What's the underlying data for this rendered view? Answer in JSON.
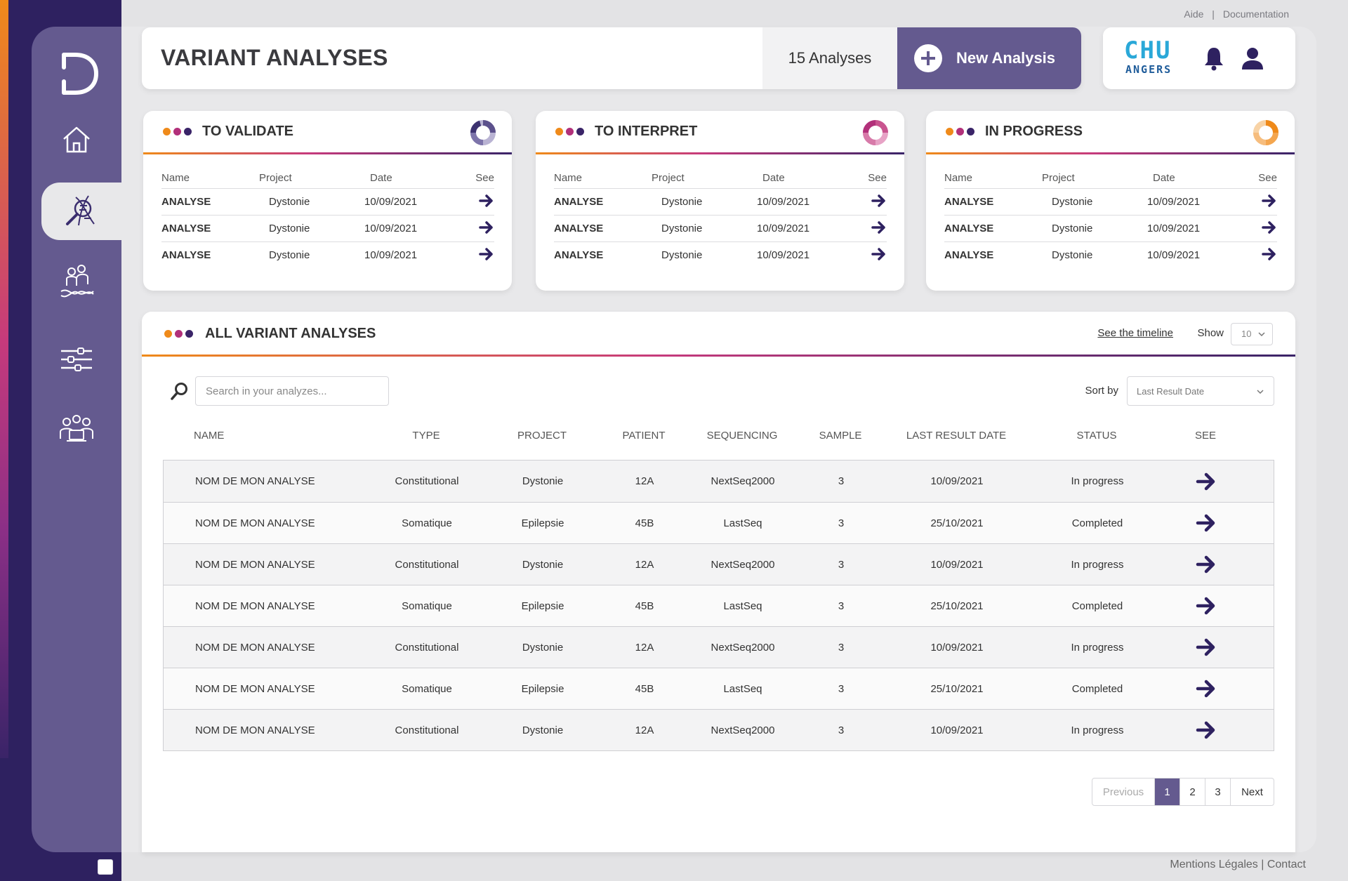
{
  "top_links": {
    "help": "Aide",
    "separator": "|",
    "docs": "Documentation"
  },
  "header": {
    "title": "VARIANT ANALYSES",
    "count": "15 Analyses",
    "new_button": "New Analysis"
  },
  "org": {
    "logo_line1": "CHU",
    "logo_line2": "ANGERS"
  },
  "colors": {
    "primary": "#645a8f",
    "dark": "#2e2160",
    "orange": "#ef8a1a",
    "magenta": "#b2307a"
  },
  "cards": [
    {
      "title": "TO VALIDATE",
      "headers": {
        "name": "Name",
        "project": "Project",
        "date": "Date",
        "see": "See"
      },
      "rows": [
        {
          "name": "ANALYSE",
          "project": "Dystonie",
          "date": "10/09/2021"
        },
        {
          "name": "ANALYSE",
          "project": "Dystonie",
          "date": "10/09/2021"
        },
        {
          "name": "ANALYSE",
          "project": "Dystonie",
          "date": "10/09/2021"
        }
      ]
    },
    {
      "title": "TO INTERPRET",
      "headers": {
        "name": "Name",
        "project": "Project",
        "date": "Date",
        "see": "See"
      },
      "rows": [
        {
          "name": "ANALYSE",
          "project": "Dystonie",
          "date": "10/09/2021"
        },
        {
          "name": "ANALYSE",
          "project": "Dystonie",
          "date": "10/09/2021"
        },
        {
          "name": "ANALYSE",
          "project": "Dystonie",
          "date": "10/09/2021"
        }
      ]
    },
    {
      "title": "IN PROGRESS",
      "headers": {
        "name": "Name",
        "project": "Project",
        "date": "Date",
        "see": "See"
      },
      "rows": [
        {
          "name": "ANALYSE",
          "project": "Dystonie",
          "date": "10/09/2021"
        },
        {
          "name": "ANALYSE",
          "project": "Dystonie",
          "date": "10/09/2021"
        },
        {
          "name": "ANALYSE",
          "project": "Dystonie",
          "date": "10/09/2021"
        }
      ]
    }
  ],
  "all": {
    "title": "ALL VARIANT ANALYSES",
    "timeline_link": "See the timeline",
    "show_label": "Show",
    "show_value": "10",
    "search_placeholder": "Search in your analyzes...",
    "sort_label": "Sort by",
    "sort_value": "Last Result Date",
    "columns": [
      "NAME",
      "TYPE",
      "PROJECT",
      "PATIENT",
      "SEQUENCING",
      "SAMPLE",
      "LAST RESULT DATE",
      "STATUS",
      "SEE"
    ],
    "rows": [
      {
        "name": "NOM DE MON ANALYSE",
        "type": "Constitutional",
        "project": "Dystonie",
        "patient": "12A",
        "sequencing": "NextSeq2000",
        "sample": "3",
        "date": "10/09/2021",
        "status": "In progress"
      },
      {
        "name": "NOM DE MON ANALYSE",
        "type": "Somatique",
        "project": "Epilepsie",
        "patient": "45B",
        "sequencing": "LastSeq",
        "sample": "3",
        "date": "25/10/2021",
        "status": "Completed"
      },
      {
        "name": "NOM DE MON ANALYSE",
        "type": "Constitutional",
        "project": "Dystonie",
        "patient": "12A",
        "sequencing": "NextSeq2000",
        "sample": "3",
        "date": "10/09/2021",
        "status": "In progress"
      },
      {
        "name": "NOM DE MON ANALYSE",
        "type": "Somatique",
        "project": "Epilepsie",
        "patient": "45B",
        "sequencing": "LastSeq",
        "sample": "3",
        "date": "25/10/2021",
        "status": "Completed"
      },
      {
        "name": "NOM DE MON ANALYSE",
        "type": "Constitutional",
        "project": "Dystonie",
        "patient": "12A",
        "sequencing": "NextSeq2000",
        "sample": "3",
        "date": "10/09/2021",
        "status": "In progress"
      },
      {
        "name": "NOM DE MON ANALYSE",
        "type": "Somatique",
        "project": "Epilepsie",
        "patient": "45B",
        "sequencing": "LastSeq",
        "sample": "3",
        "date": "25/10/2021",
        "status": "Completed"
      },
      {
        "name": "NOM DE MON ANALYSE",
        "type": "Constitutional",
        "project": "Dystonie",
        "patient": "12A",
        "sequencing": "NextSeq2000",
        "sample": "3",
        "date": "10/09/2021",
        "status": "In progress"
      }
    ],
    "pagination": {
      "previous": "Previous",
      "pages": [
        "1",
        "2",
        "3"
      ],
      "next": "Next",
      "current": "1"
    }
  },
  "footer": {
    "text": "Mentions Légales | Contact"
  },
  "nav": {
    "icons": [
      "home-icon",
      "dna-search-icon",
      "patients-dna-icon",
      "settings-sliders-icon",
      "team-icon"
    ]
  }
}
